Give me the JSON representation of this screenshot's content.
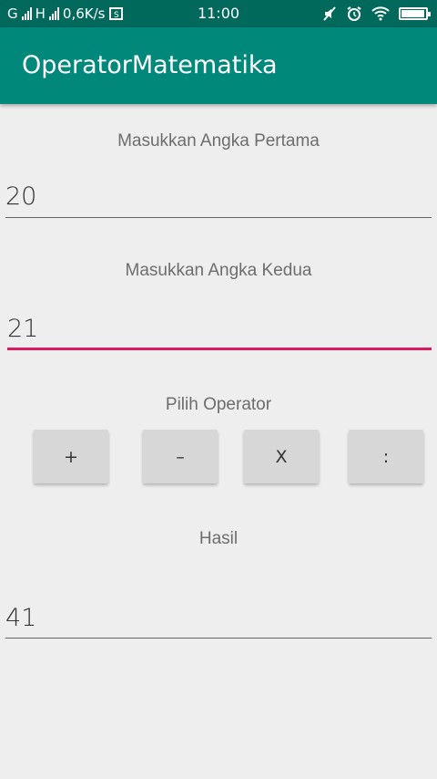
{
  "status_bar": {
    "sim1": "G",
    "sim2": "H",
    "speed": "0,6K/s",
    "time": "11:00",
    "battery_level": 0.95
  },
  "app_bar": {
    "title": "OperatorMatematika"
  },
  "first_number": {
    "label": "Masukkan Angka Pertama",
    "value": "20"
  },
  "second_number": {
    "label": "Masukkan Angka Kedua",
    "value": "21"
  },
  "operator": {
    "label": "Pilih Operator",
    "buttons": [
      "+",
      "–",
      "X",
      ":"
    ]
  },
  "result": {
    "label": "Hasil",
    "value": "41"
  },
  "colors": {
    "status_bar": "#00695c",
    "app_bar": "#00897b",
    "accent": "#d81b60",
    "background": "#eeeeee"
  }
}
